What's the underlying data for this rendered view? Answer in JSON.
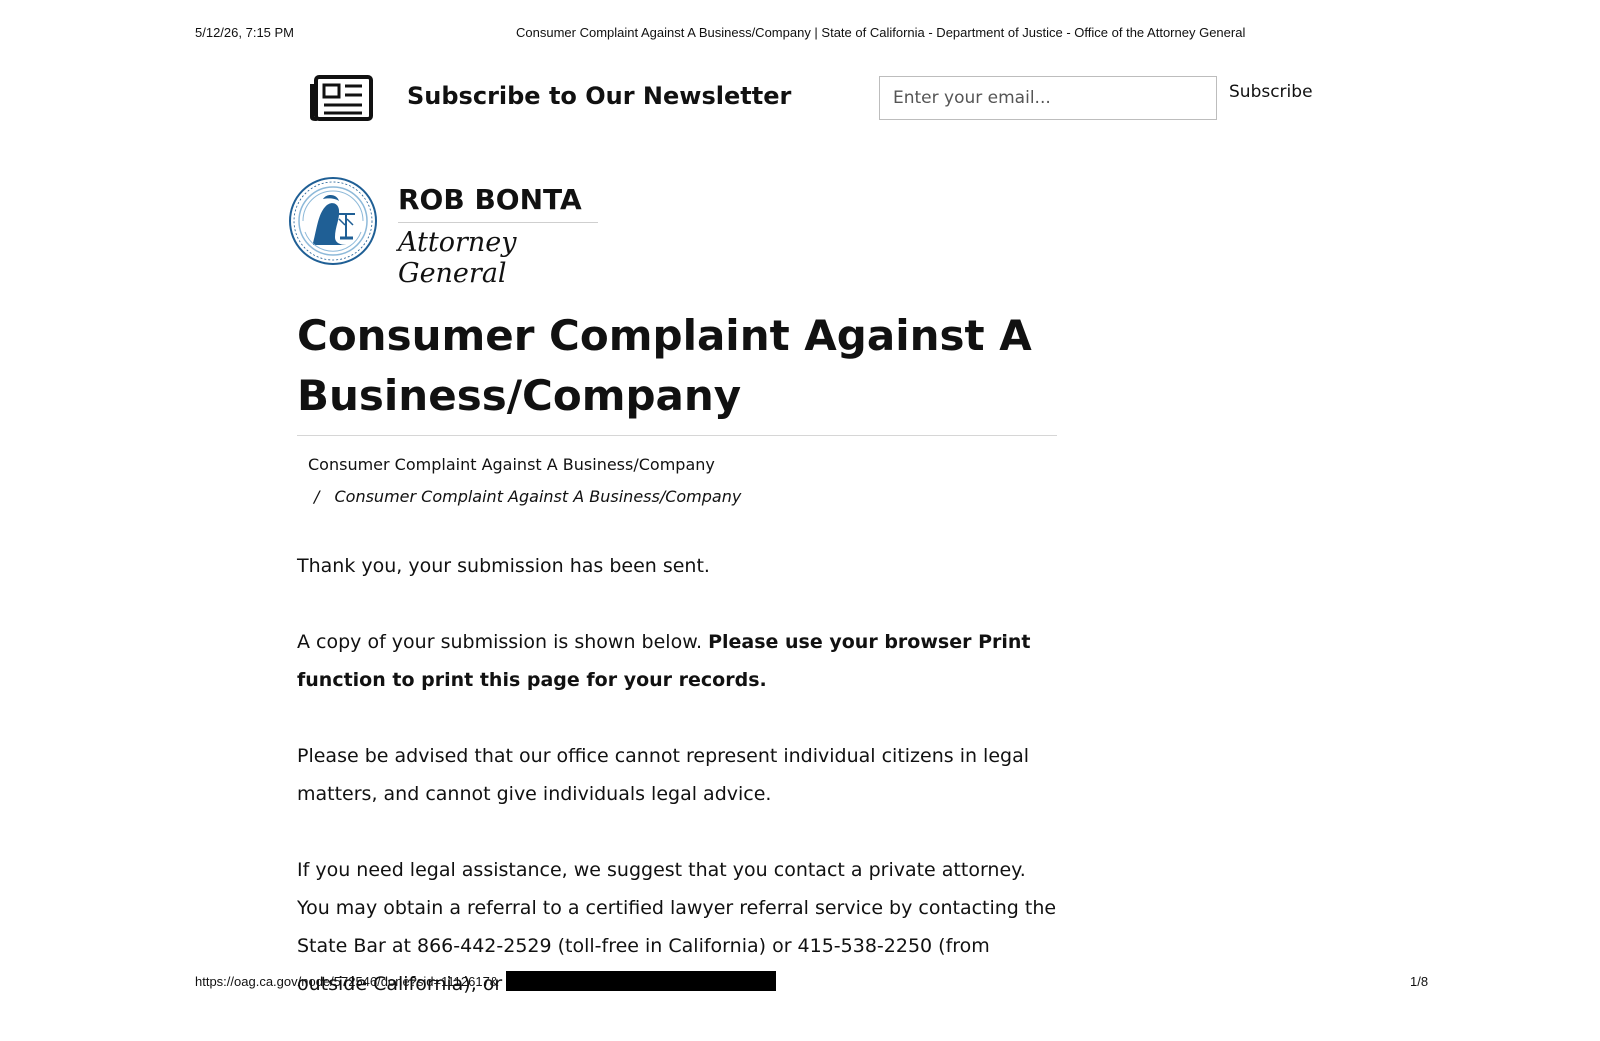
{
  "print_header": {
    "date": "5/12/26, 7:15 PM",
    "title": "Consumer Complaint Against A Business/Company | State of California - Department of Justice - Office of the Attorney General"
  },
  "newsletter": {
    "icon": "newspaper-icon",
    "title": "Subscribe to Our Newsletter",
    "email_placeholder": "Enter your email...",
    "subscribe_label": "Subscribe"
  },
  "brand": {
    "seal_icon": "attorney-general-seal-icon",
    "seal_colors": {
      "primary": "#1f5f95",
      "light": "#8db9d9"
    },
    "name": "ROB BONTA",
    "role": "Attorney General"
  },
  "page": {
    "title": "Consumer Complaint Against A Business/Company",
    "breadcrumb": {
      "link": "Consumer Complaint Against A Business/Company",
      "separator": "/",
      "current": "Consumer Complaint Against A Business/Company"
    }
  },
  "content": {
    "thank_you": "Thank you, your submission has been sent.",
    "copy_intro": "A copy of your submission is shown below. ",
    "copy_bold": "Please use your browser Print function to print this page for your records.",
    "advice": "Please be advised that our office cannot represent individual citizens in legal matters, and cannot give individuals legal advice.",
    "referral": "If you need legal assistance, we suggest that you contact a private attorney. You may obtain a referral to a certified lawyer referral service by contacting the State Bar at 866-442-2529 (toll-free in California) or 415-538-2250 (from outside California), or via"
  },
  "print_footer": {
    "url": "https://oag.ca.gov/node/572546/done?sid=1112617&",
    "page": "1/8"
  }
}
